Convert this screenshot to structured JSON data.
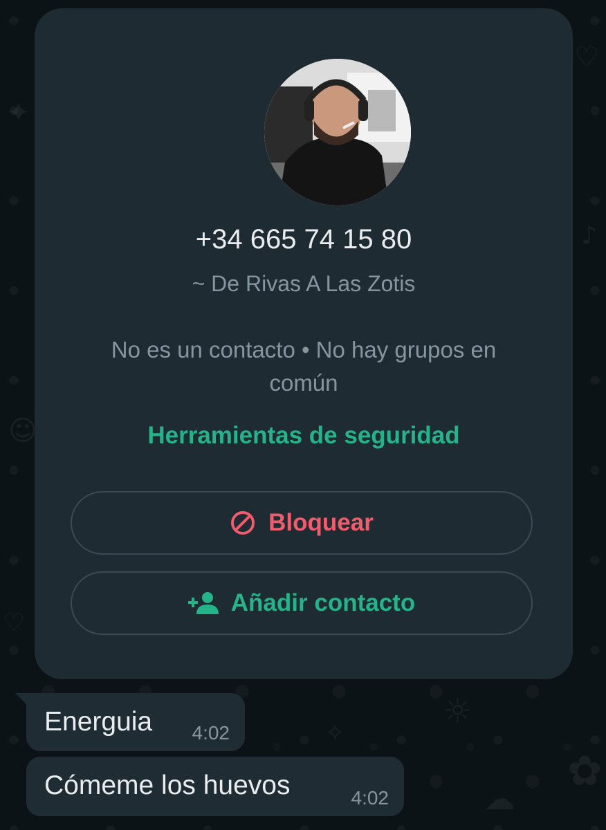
{
  "contact_card": {
    "phone_number": "+34 665 74 15 80",
    "push_name": "~ De Rivas A Las Zotis",
    "status_line": "No es un contacto • No hay grupos en común",
    "security_link": "Herramientas de seguridad",
    "block_button_label": "Bloquear",
    "add_contact_button_label": "Añadir contacto"
  },
  "messages": [
    {
      "text": "Energuia",
      "time": "4:02"
    },
    {
      "text": "Cómeme los huevos",
      "time": "4:02"
    }
  ],
  "colors": {
    "card_background": "#1f2b32",
    "accent_green": "#25b389",
    "danger_red": "#f15c6d",
    "bubble_background": "#202c33",
    "muted_text": "#8696a0"
  },
  "icons": {
    "block": "block-icon",
    "add_contact": "person-add-icon"
  }
}
